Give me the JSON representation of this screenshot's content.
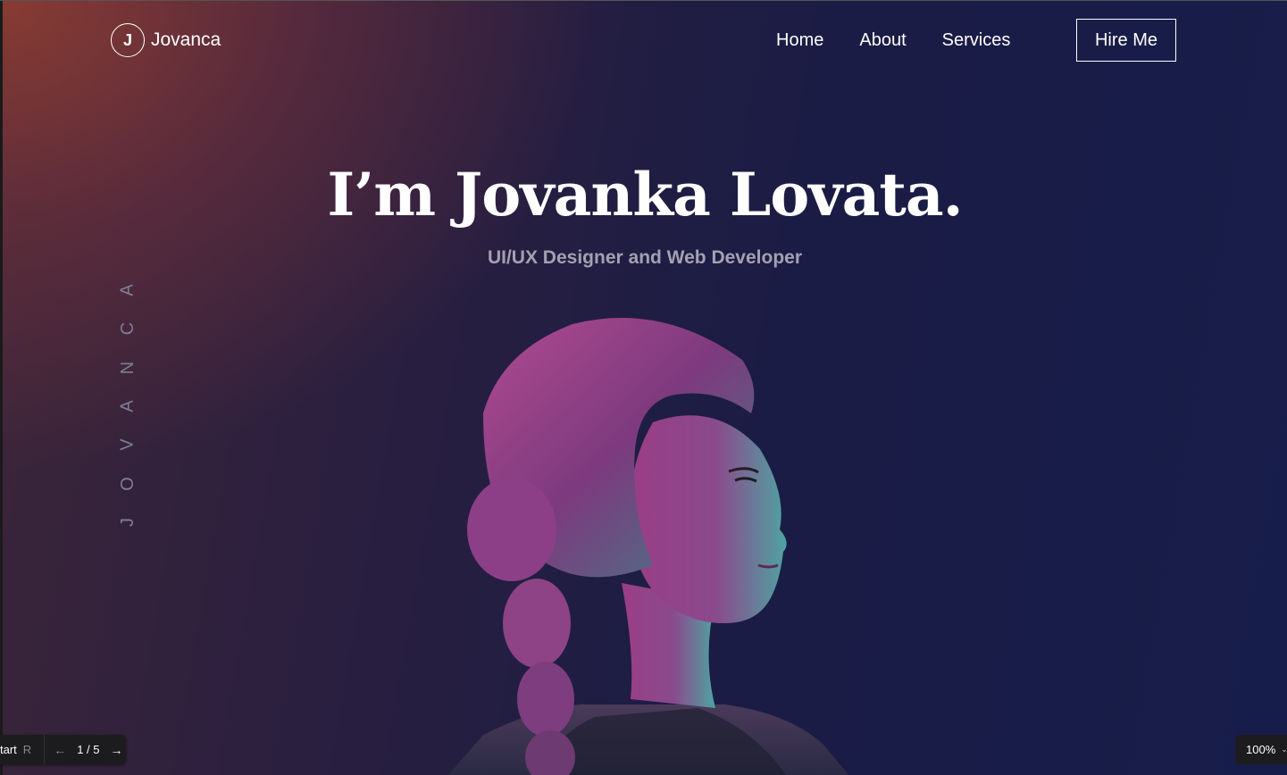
{
  "header": {
    "logo_letter": "J",
    "logo_name": "Jovanca",
    "nav": [
      "Home",
      "About",
      "Services"
    ],
    "cta_label": "Hire Me"
  },
  "hero": {
    "title": "I’m Jovanka Lovata.",
    "subtitle": "UI/UX Designer and Web Developer",
    "vertical_letters": [
      "J",
      "O",
      "V",
      "A",
      "N",
      "C",
      "A"
    ]
  },
  "viewer": {
    "start_label": "tart",
    "start_key": "R",
    "prev_icon": "←",
    "page_indicator": "1 / 5",
    "next_icon": "→",
    "zoom": "100%",
    "zoom_chevron": "⌄"
  },
  "colors": {
    "accent_warm": "#8c3c32",
    "background": "#171d4a",
    "text": "#ffffff",
    "subtitle": "#a3a1b1"
  }
}
